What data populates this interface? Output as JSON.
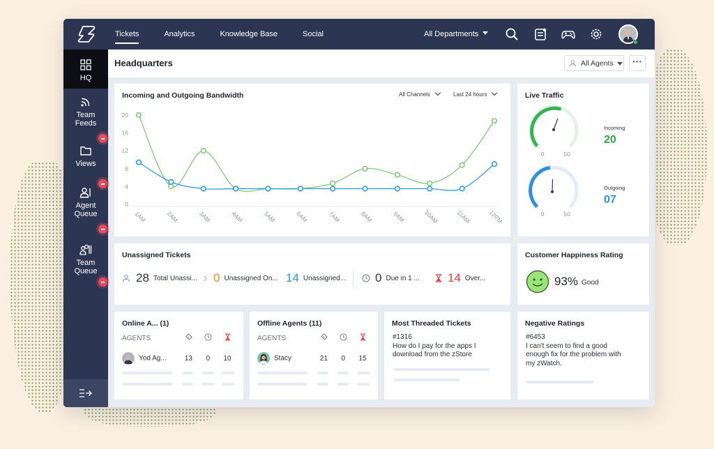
{
  "topnav": {
    "tabs": [
      {
        "label": "Tickets"
      },
      {
        "label": "Analytics"
      },
      {
        "label": "Knowledge Base"
      },
      {
        "label": "Social"
      }
    ],
    "department": "All Departments"
  },
  "sidebar": {
    "items": [
      {
        "label": "HQ"
      },
      {
        "line1": "Team",
        "line2": "Feeds"
      },
      {
        "label": "Views"
      },
      {
        "line1": "Agent",
        "line2": "Queue"
      },
      {
        "line1": "Team",
        "line2": "Queue"
      }
    ]
  },
  "header": {
    "title": "Headquarters",
    "agents_filter": "All Agents"
  },
  "bandwidth": {
    "title": "Incoming and Outgoing Bandwidth",
    "channel_filter": "All Channels",
    "time_filter": "Last 24 hours"
  },
  "chart_data": {
    "type": "line",
    "categories": [
      "1AM",
      "2AM",
      "3AM",
      "4AM",
      "5AM",
      "6AM",
      "7AM",
      "8AM",
      "9AM",
      "10AM",
      "11AM",
      "12PM"
    ],
    "yticks": [
      0,
      4,
      8,
      12,
      16,
      20
    ],
    "ylim": [
      0,
      20
    ],
    "grid": false,
    "series": [
      {
        "color": "#7fc97a",
        "values": [
          20,
          4,
          12,
          3.5,
          3.5,
          3.5,
          4.7,
          8,
          6.6,
          4.7,
          8.8,
          18.7
        ]
      },
      {
        "color": "#2f9be6",
        "values": [
          9.4,
          5,
          3.5,
          3.5,
          3.5,
          3.5,
          3.5,
          3.5,
          3.5,
          3.5,
          3.5,
          9
        ]
      }
    ]
  },
  "live_traffic": {
    "title": "Live Traffic",
    "incoming": {
      "label": "Incoming",
      "value": "20",
      "min": "0",
      "max": "50",
      "color": "#2aa84a"
    },
    "outgoing": {
      "label": "Outgoing",
      "value": "07",
      "min": "0",
      "max": "50",
      "color": "#2f8fe0"
    }
  },
  "unassigned": {
    "title": "Unassigned Tickets",
    "total": {
      "value": "28",
      "label": "Total Unassi..."
    },
    "online": {
      "value": "0",
      "label": "Unassigned On...",
      "color": "#f08a24"
    },
    "offline": {
      "value": "14",
      "label": "Unassigned...",
      "color": "#2f8fe0"
    },
    "due": {
      "value": "0",
      "label": "Due in 1 ..."
    },
    "overdue": {
      "value": "14",
      "label": "Over...",
      "color": "#e03a3a"
    }
  },
  "happiness": {
    "title": "Customer Happiness Rating",
    "percent": "93%",
    "label": "Good"
  },
  "online_agents": {
    "title": "Online A... (1)",
    "header": "AGENTS",
    "rows": [
      {
        "name": "Yod Ag...",
        "a": "13",
        "b": "0",
        "c": "10"
      }
    ]
  },
  "offline_agents": {
    "title": "Offline Agents (11)",
    "header": "AGENTS",
    "rows": [
      {
        "name": "Stacy",
        "a": "21",
        "b": "0",
        "c": "15"
      }
    ]
  },
  "threaded": {
    "title": "Most Threaded Tickets",
    "ticket_id": "#1316",
    "text": "How do I pay for the apps I download from the zStore"
  },
  "negative": {
    "title": "Negative Ratings",
    "ticket_id": "#6453",
    "text": "I can't seem to find a good enough fix for the problem with my zWatch."
  }
}
